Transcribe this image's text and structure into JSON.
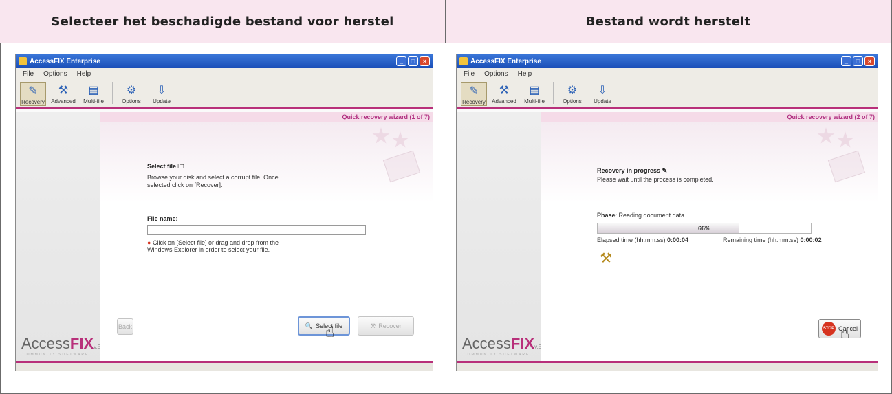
{
  "headers": {
    "left": "Selecteer het beschadigde bestand voor herstel",
    "right": "Bestand wordt herstelt"
  },
  "app": {
    "title": "AccessFIX Enterprise",
    "menu": [
      "File",
      "Options",
      "Help"
    ],
    "toolbar": [
      "Recovery",
      "Advanced",
      "Multi-file",
      "Options",
      "Update"
    ],
    "logo_main": "Access",
    "logo_fix": "FIX",
    "logo_ver": "v.5",
    "logo_sub": "COMMUNITY SOFTWARE"
  },
  "panel1": {
    "wizard_label": "Quick recovery wizard (1 of 7)",
    "select_title": "Select file",
    "select_desc": "Browse your disk and select a corrupt file. Once selected click on [Recover].",
    "file_label": "File name:",
    "file_value": "",
    "hint": "Click on [Select file] or drag and drop from the Windows Explorer in order to select your file.",
    "back_label": "Back",
    "select_label": "Select file",
    "recover_label": "Recover"
  },
  "panel2": {
    "wizard_label": "Quick recovery wizard (2 of 7)",
    "progress_title": "Recovery in progress",
    "progress_desc": "Please wait until the process is completed.",
    "phase_label": "Phase",
    "phase_value": ": Reading document data",
    "percent_text": "66%",
    "percent": 66,
    "elapsed_label": "Elapsed time (hh:mm:ss)",
    "elapsed_value": "0:00:04",
    "remaining_label": "Remaining time (hh:mm:ss)",
    "remaining_value": "0:00:02",
    "cancel_label": "Cancel",
    "stop_label": "STOP"
  },
  "colors": {
    "accent": "#b8307a",
    "header_bg": "#f9e6ef"
  }
}
